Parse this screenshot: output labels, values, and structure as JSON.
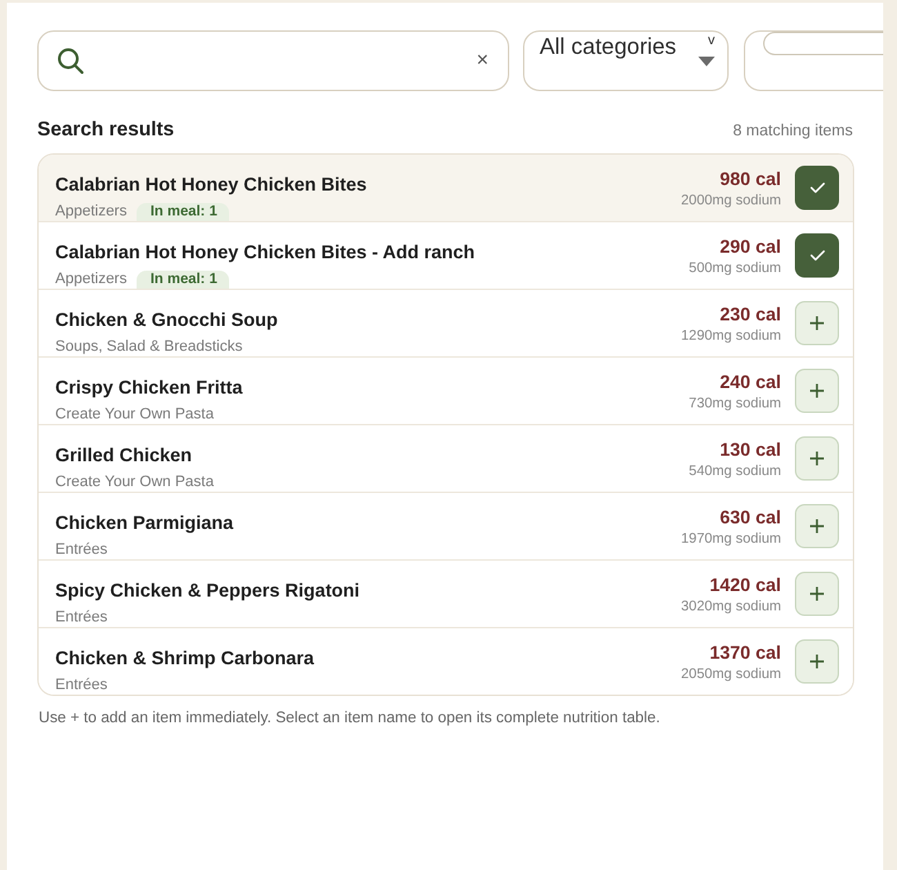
{
  "controls": [
    {
      "kind": "search",
      "clear": "×"
    },
    {
      "kind": "select",
      "value": "All categories",
      "chevron": "v"
    },
    {
      "kind": "pill_field"
    }
  ],
  "results": {
    "title": "Search results",
    "count": "8 matching items",
    "items": [
      {
        "name": "Calabrian Hot Honey Chicken Bites",
        "category": "Appetizers",
        "badge": "In meal: 1",
        "calories": "980 cal",
        "sodium": "2000mg sodium",
        "in_meal": true,
        "highlighted": true
      },
      {
        "name": "Calabrian Hot Honey Chicken Bites - Add ranch",
        "category": "Appetizers",
        "badge": "In meal: 1",
        "calories": "290 cal",
        "sodium": "500mg sodium",
        "in_meal": true,
        "highlighted": false
      },
      {
        "name": "Chicken & Gnocchi Soup",
        "category": "Soups, Salad & Breadsticks",
        "calories": "230 cal",
        "sodium": "1290mg sodium",
        "in_meal": false,
        "highlighted": false
      },
      {
        "name": "Crispy Chicken Fritta",
        "category": "Create Your Own Pasta",
        "calories": "240 cal",
        "sodium": "730mg sodium",
        "in_meal": false,
        "highlighted": false
      },
      {
        "name": "Grilled Chicken",
        "category": "Create Your Own Pasta",
        "calories": "130 cal",
        "sodium": "540mg sodium",
        "in_meal": false,
        "highlighted": false
      },
      {
        "name": "Chicken Parmigiana",
        "category": "Entrées",
        "calories": "630 cal",
        "sodium": "1970mg sodium",
        "in_meal": false,
        "highlighted": false
      },
      {
        "name": "Spicy Chicken & Peppers Rigatoni",
        "category": "Entrées",
        "calories": "1420 cal",
        "sodium": "3020mg sodium",
        "in_meal": false,
        "highlighted": false
      },
      {
        "name": "Chicken & Shrimp Carbonara",
        "category": "Entrées",
        "calories": "1370 cal",
        "sodium": "2050mg sodium",
        "in_meal": false,
        "highlighted": false
      }
    ]
  },
  "hint": "Use + to add an item immediately. Select an item name to open its complete nutrition table."
}
